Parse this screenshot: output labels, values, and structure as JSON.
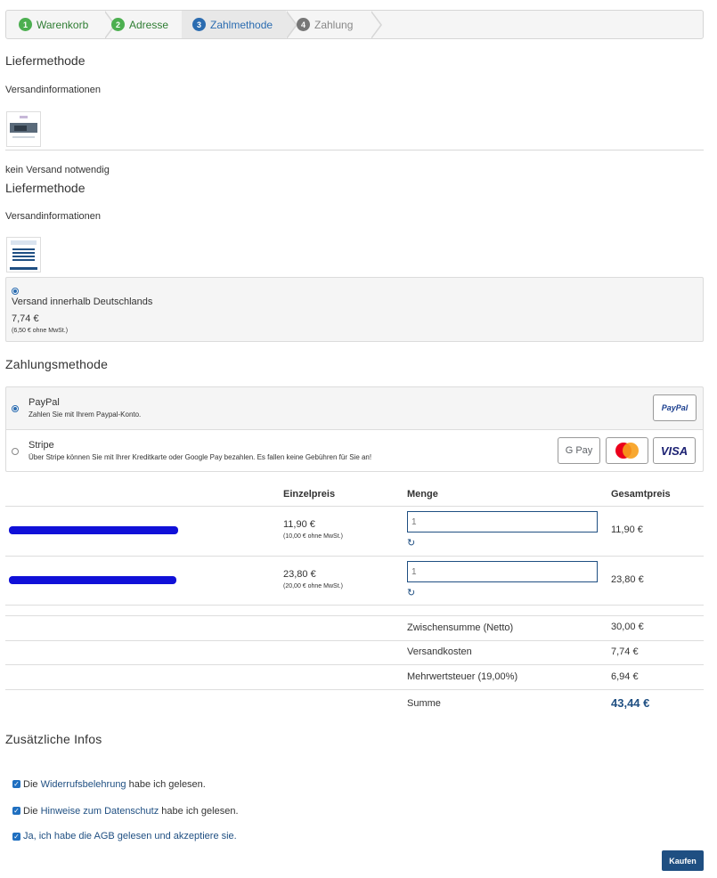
{
  "steps": [
    {
      "num": "1",
      "label": "Warenkorb",
      "color": "#4caf50",
      "text_color": "#2e7d32"
    },
    {
      "num": "2",
      "label": "Adresse",
      "color": "#4caf50",
      "text_color": "#2e7d32"
    },
    {
      "num": "3",
      "label": "Zahlmethode",
      "color": "#2b6cb0",
      "text_color": "#2b6cb0"
    },
    {
      "num": "4",
      "label": "Zahlung",
      "color": "#888888",
      "text_color": "#888888"
    }
  ],
  "delivery1": {
    "title": "Liefermethode",
    "subtitle": "Versandinformationen",
    "note": "kein Versand notwendig"
  },
  "delivery2": {
    "title": "Liefermethode",
    "subtitle": "Versandinformationen",
    "option_label": "Versand innerhalb Deutschlands",
    "price": "7,74 €",
    "price_net": "(6,50 € ohne MwSt.)"
  },
  "payment": {
    "title": "Zahlungsmethode",
    "paypal_label": "PayPal",
    "paypal_desc": "Zahlen Sie mit Ihrem Paypal-Konto.",
    "stripe_label": "Stripe",
    "stripe_desc": "Über Stripe können Sie mit Ihrer Kreditkarte oder Google Pay bezahlen. Es fallen keine Gebühren für Sie an!",
    "paypal_logo": "PayPal",
    "gpay_logo": "G Pay",
    "visa_logo": "VISA"
  },
  "cart": {
    "headers": [
      "Einzelpreis",
      "Menge",
      "Gesamtpreis"
    ],
    "rows": [
      {
        "price": "11,90 €",
        "price_net": "(10,00 € ohne MwSt.)",
        "qty": "1",
        "total": "11,90 €"
      },
      {
        "price": "23,80 €",
        "price_net": "(20,00 € ohne MwSt.)",
        "qty": "1",
        "total": "23,80 €"
      }
    ]
  },
  "totals": {
    "subtotal_label": "Zwischensumme (Netto)",
    "subtotal": "30,00 €",
    "shipping_label": "Versandkosten",
    "shipping": "7,74 €",
    "tax_label": "Mehrwertsteuer (19,00%)",
    "tax": "6,94 €",
    "sum_label": "Summe",
    "sum": "43,44 €"
  },
  "extra": {
    "title": "Zusätzliche Infos",
    "check1_pre": "Die ",
    "check1_link": "Widerrufsbelehrung",
    "check1_post": " habe ich gelesen.",
    "check2_pre": "Die ",
    "check2_link": "Hinweise zum Datenschutz",
    "check2_post": " habe ich gelesen.",
    "check3_pre": "Ja, ich habe die ",
    "check3_link": "AGB",
    "check3_post": " gelesen und akzeptiere sie."
  },
  "buy_label": "Kaufen"
}
